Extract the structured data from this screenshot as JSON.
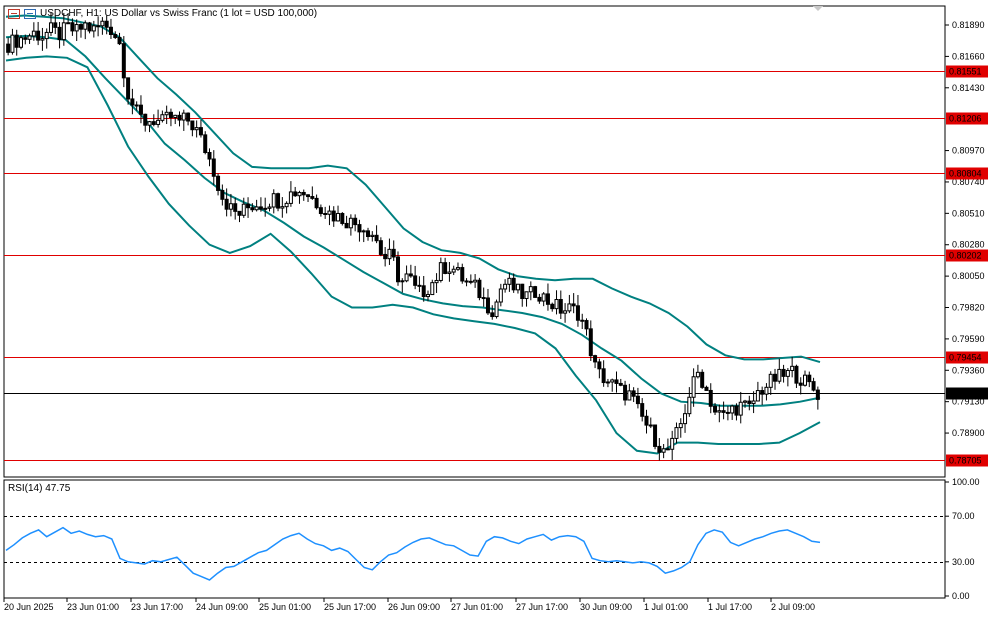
{
  "header": {
    "symbol_line": "USDCHF, H1:  US Dollar vs Swiss Franc (1 lot = USD 100,000)"
  },
  "rsi_panel": {
    "label": "RSI(14) 47.75"
  },
  "colors": {
    "candle": "#000000",
    "band": "#008080",
    "level_line": "#e00000",
    "level_tag_bg": "#e00000",
    "rsi_line": "#1e90ff",
    "price_line": "#000000"
  },
  "chart_data": [
    {
      "type": "candlestick",
      "title": "USDCHF, H1:  US Dollar vs Swiss Franc (1 lot = USD 100,000)",
      "ylim": [
        0.786,
        0.82
      ],
      "y_ticks": [
        "0.81890",
        "0.81660",
        "0.81430",
        "0.80970",
        "0.80740",
        "0.80510",
        "0.80280",
        "0.80050",
        "0.79820",
        "0.79590",
        "0.79360",
        "0.79130",
        "0.78900"
      ],
      "x_ticks": [
        "20 Jun 2025",
        "23 Jun 01:00",
        "23 Jun 17:00",
        "24 Jun 09:00",
        "25 Jun 01:00",
        "25 Jun 17:00",
        "26 Jun 09:00",
        "27 Jun 01:00",
        "27 Jun 17:00",
        "30 Jun 09:00",
        "1 Jul 01:00",
        "1 Jul 17:00",
        "2 Jul 09:00"
      ],
      "price_levels": [
        "0.81551",
        "0.81206",
        "0.80804",
        "0.80202",
        "0.79454",
        "0.78705"
      ],
      "current_price": "0.79190",
      "close_path": [
        0.8175,
        0.8178,
        0.818,
        0.8183,
        0.8181,
        0.8185,
        0.8182,
        0.8187,
        0.8184,
        0.8189,
        0.8185,
        0.819,
        0.8187,
        0.8178,
        0.814,
        0.8125,
        0.8118,
        0.812,
        0.8117,
        0.8122,
        0.8118,
        0.812,
        0.8113,
        0.81,
        0.8085,
        0.8065,
        0.8055,
        0.805,
        0.8055,
        0.8058,
        0.8058,
        0.8062,
        0.806,
        0.8065,
        0.8068,
        0.8066,
        0.806,
        0.8055,
        0.805,
        0.8048,
        0.8045,
        0.8043,
        0.804,
        0.8035,
        0.8018,
        0.802,
        0.8,
        0.8005,
        0.7992,
        0.7995,
        0.8002,
        0.8012,
        0.8012,
        0.8005,
        0.7999,
        0.7996,
        0.7985,
        0.798,
        0.8,
        0.7998,
        0.7992,
        0.799,
        0.7995,
        0.7988,
        0.7984,
        0.798,
        0.7981,
        0.7978,
        0.796,
        0.7935,
        0.793,
        0.7925,
        0.792,
        0.7918,
        0.7905,
        0.7895,
        0.7885,
        0.7875,
        0.7882,
        0.7898,
        0.792,
        0.7935,
        0.792,
        0.7905,
        0.7902,
        0.7908,
        0.791,
        0.7908,
        0.792,
        0.7925,
        0.793,
        0.7932,
        0.7935,
        0.793,
        0.7925,
        0.7919
      ],
      "bollinger": {
        "upper": [
          0.8195,
          0.8196,
          0.8195,
          0.8194,
          0.8191,
          0.8188,
          0.818,
          0.8165,
          0.815,
          0.8138,
          0.8125,
          0.811,
          0.8095,
          0.8085,
          0.8084,
          0.8084,
          0.8084,
          0.8086,
          0.8084,
          0.8072,
          0.8056,
          0.804,
          0.803,
          0.8024,
          0.8022,
          0.8018,
          0.801,
          0.8005,
          0.8003,
          0.8002,
          0.8003,
          0.8003,
          0.7996,
          0.799,
          0.7985,
          0.7978,
          0.7968,
          0.7955,
          0.7947,
          0.7944,
          0.7944,
          0.7945,
          0.7946,
          0.7942
        ],
        "middle": [
          0.818,
          0.8181,
          0.818,
          0.8178,
          0.8166,
          0.815,
          0.8135,
          0.812,
          0.8102,
          0.809,
          0.8077,
          0.8066,
          0.8059,
          0.8053,
          0.8044,
          0.8034,
          0.8026,
          0.8017,
          0.8008,
          0.8,
          0.7992,
          0.7988,
          0.7985,
          0.7983,
          0.7982,
          0.798,
          0.7978,
          0.7975,
          0.797,
          0.7962,
          0.7952,
          0.7943,
          0.793,
          0.7919,
          0.7913,
          0.7912,
          0.791,
          0.791,
          0.791,
          0.7911,
          0.7913,
          0.7916
        ],
        "lower": [
          0.8163,
          0.8165,
          0.8166,
          0.8165,
          0.8158,
          0.813,
          0.81,
          0.8078,
          0.8058,
          0.8042,
          0.8028,
          0.8022,
          0.8027,
          0.8036,
          0.8023,
          0.8007,
          0.799,
          0.7982,
          0.7982,
          0.7984,
          0.7982,
          0.7977,
          0.7974,
          0.7972,
          0.797,
          0.7967,
          0.7963,
          0.7952,
          0.7932,
          0.7914,
          0.789,
          0.7877,
          0.7875,
          0.7883,
          0.7883,
          0.7882,
          0.7882,
          0.7882,
          0.7883,
          0.789,
          0.7898
        ]
      }
    },
    {
      "type": "line",
      "title": "RSI(14) 47.75",
      "ylim": [
        0,
        100
      ],
      "y_ticks": [
        "100.00",
        "70.00",
        "30.00",
        "0.00"
      ],
      "levels": [
        70,
        30
      ],
      "series": [
        {
          "values": [
            40,
            45,
            51,
            55,
            58,
            52,
            56,
            60,
            55,
            57,
            54,
            52,
            53,
            50,
            33,
            30,
            29,
            28,
            31,
            30,
            32,
            34,
            27,
            20,
            17,
            14,
            20,
            25,
            26,
            30,
            34,
            38,
            40,
            45,
            50,
            53,
            55,
            50,
            46,
            44,
            40,
            42,
            39,
            32,
            25,
            23,
            30,
            36,
            38,
            43,
            47,
            50,
            51,
            48,
            45,
            44,
            40,
            36,
            35,
            48,
            52,
            51,
            48,
            46,
            50,
            52,
            54,
            49,
            52,
            53,
            52,
            48,
            33,
            31,
            30,
            31,
            30,
            29,
            30,
            29,
            26,
            20,
            22,
            25,
            30,
            45,
            55,
            58,
            56,
            47,
            44,
            47,
            50,
            52,
            55,
            57,
            58,
            55,
            52,
            48,
            47
          ]
        }
      ]
    }
  ]
}
